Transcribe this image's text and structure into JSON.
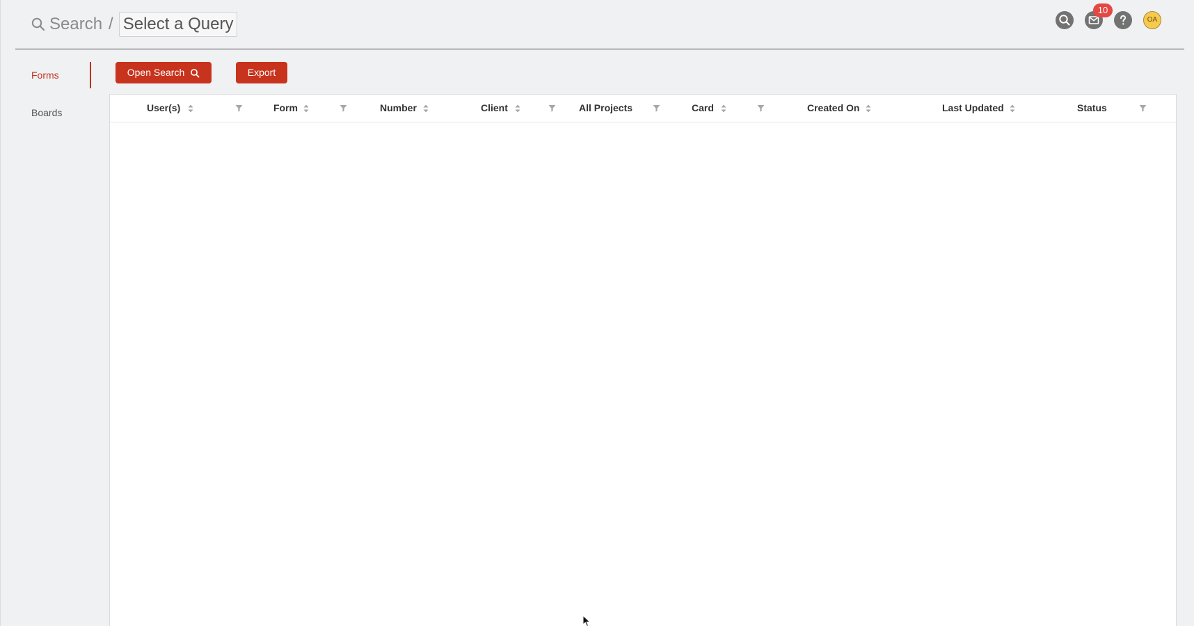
{
  "header": {
    "breadcrumb_search": "Search",
    "breadcrumb_separator": "/",
    "query_select_value": "Select a Query",
    "notification_count": "10",
    "avatar_initials": "OA"
  },
  "sidebar": {
    "items": [
      {
        "label": "Forms",
        "active": true
      },
      {
        "label": "Boards",
        "active": false
      }
    ]
  },
  "toolbar": {
    "open_search_label": "Open Search",
    "export_label": "Export"
  },
  "grid": {
    "columns": [
      {
        "label": "User(s)",
        "sortable": true,
        "filterable": true
      },
      {
        "label": "Form",
        "sortable": true,
        "filterable": true
      },
      {
        "label": "Number",
        "sortable": true,
        "filterable": false
      },
      {
        "label": "Client",
        "sortable": true,
        "filterable": true
      },
      {
        "label": "All Projects",
        "sortable": false,
        "filterable": true
      },
      {
        "label": "Card",
        "sortable": true,
        "filterable": true
      },
      {
        "label": "Created On",
        "sortable": true,
        "filterable": false
      },
      {
        "label": "Last Updated",
        "sortable": true,
        "filterable": false
      },
      {
        "label": "Status",
        "sortable": false,
        "filterable": true
      }
    ],
    "rows": []
  },
  "colors": {
    "accent": "#c7331d",
    "active_nav": "#c0321f",
    "badge": "#e34843",
    "avatar": "#f6c94f"
  },
  "icons": {
    "breadcrumb": "search-icon",
    "header": [
      "search-icon",
      "mail-icon",
      "help-icon",
      "avatar"
    ],
    "sort": "sort-icon",
    "filter": "filter-icon"
  }
}
